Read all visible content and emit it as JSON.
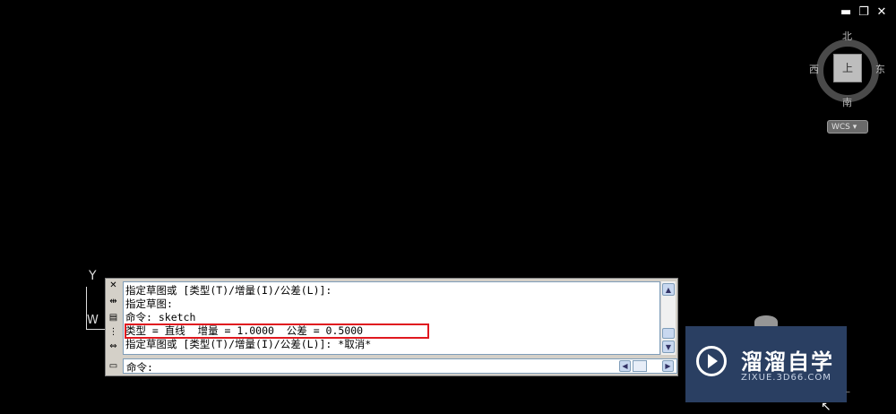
{
  "window": {
    "controls": {
      "minimize": "▬",
      "restore": "❐",
      "close": "✕"
    }
  },
  "viewcube": {
    "north": "北",
    "south": "南",
    "west": "西",
    "east": "东",
    "face": "上",
    "wcs_label": "WCS"
  },
  "ucs": {
    "y": "Y",
    "w": "W"
  },
  "command_window": {
    "side_icons": [
      "close-icon",
      "pin-icon",
      "properties-icon",
      "grip-icon",
      "tool-icon",
      "window-icon"
    ],
    "history": [
      "指定草图或 [类型(T)/增量(I)/公差(L)]:",
      "指定草图:",
      "命令: sketch",
      "类型 = 直线  增量 = 1.0000  公差 = 0.5000",
      "指定草图或 [类型(T)/增量(I)/公差(L)]: *取消*"
    ],
    "prompt": "命令:",
    "scroll_up": "▲",
    "scroll_down": "▼",
    "scroll_left": "◀",
    "scroll_right": "▶"
  },
  "watermark": {
    "title": "溜溜自学",
    "url": "ZIXUE.3D66.COM"
  },
  "colors": {
    "highlight_border": "#e0181f",
    "logo_bg": "#2a3f62"
  }
}
